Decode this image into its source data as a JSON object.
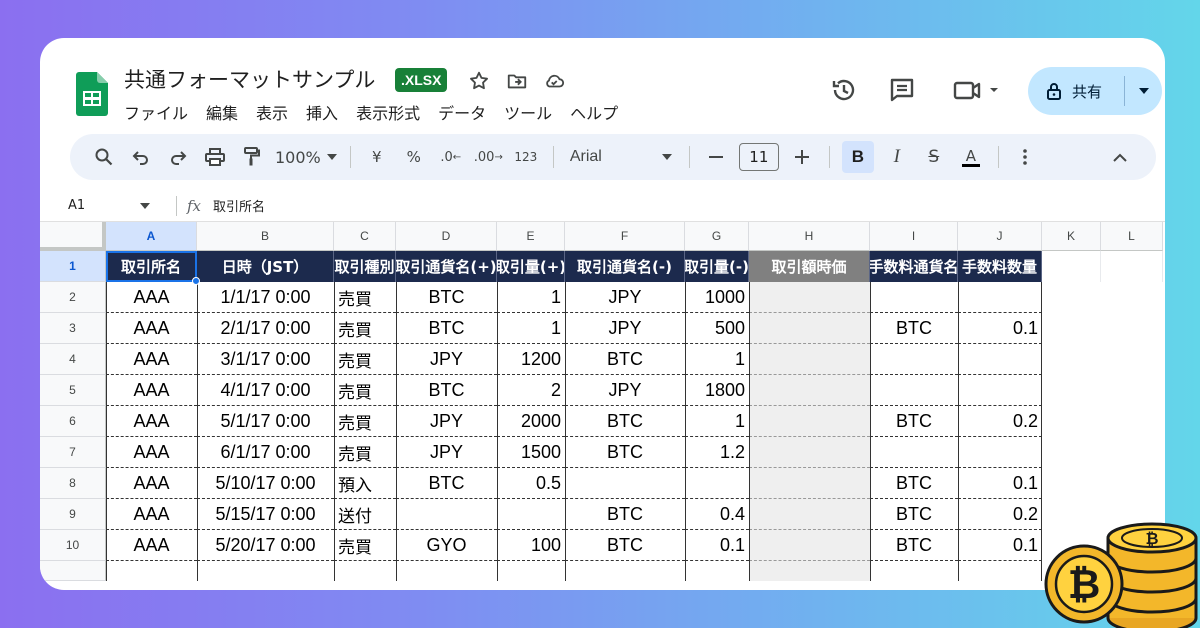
{
  "doc": {
    "title": "共通フォーマットサンプル",
    "badge": ".XLSX"
  },
  "menu": [
    "ファイル",
    "編集",
    "表示",
    "挿入",
    "表示形式",
    "データ",
    "ツール",
    "ヘルプ"
  ],
  "share": {
    "label": "共有"
  },
  "toolbar": {
    "zoom": "100%",
    "currency": "¥",
    "percent": "%",
    "dec_decrease": ".0",
    "dec_increase": ".00",
    "number_format": "123",
    "font": "Arial",
    "font_size": "11",
    "bold": "B",
    "italic": "I",
    "strike": "S",
    "text_color": "A"
  },
  "formula_bar": {
    "cell_ref": "A1",
    "fx": "fx",
    "content": "取引所名"
  },
  "columns": [
    "A",
    "B",
    "C",
    "D",
    "E",
    "F",
    "G",
    "H",
    "I",
    "J",
    "K",
    "L"
  ],
  "row_numbers": [
    "1",
    "2",
    "3",
    "4",
    "5",
    "6",
    "7",
    "8",
    "9",
    "10"
  ],
  "headers": [
    "取引所名",
    "日時（JST）",
    "取引種別",
    "取引通貨名(+)",
    "取引量(+)",
    "取引通貨名(-)",
    "取引量(-)",
    "取引額時価",
    "手数料通貨名",
    "手数料数量"
  ],
  "rows": [
    [
      "AAA",
      "1/1/17 0:00",
      "売買",
      "BTC",
      "1",
      "JPY",
      "1000",
      "",
      "",
      ""
    ],
    [
      "AAA",
      "2/1/17 0:00",
      "売買",
      "BTC",
      "1",
      "JPY",
      "500",
      "",
      "BTC",
      "0.1"
    ],
    [
      "AAA",
      "3/1/17 0:00",
      "売買",
      "JPY",
      "1200",
      "BTC",
      "1",
      "",
      "",
      ""
    ],
    [
      "AAA",
      "4/1/17 0:00",
      "売買",
      "BTC",
      "2",
      "JPY",
      "1800",
      "",
      "",
      ""
    ],
    [
      "AAA",
      "5/1/17 0:00",
      "売買",
      "JPY",
      "2000",
      "BTC",
      "1",
      "",
      "BTC",
      "0.2"
    ],
    [
      "AAA",
      "6/1/17 0:00",
      "売買",
      "JPY",
      "1500",
      "BTC",
      "1.2",
      "",
      "",
      ""
    ],
    [
      "AAA",
      "5/10/17 0:00",
      "預入",
      "BTC",
      "0.5",
      "",
      "",
      "",
      "BTC",
      "0.1"
    ],
    [
      "AAA",
      "5/15/17 0:00",
      "送付",
      "",
      "",
      "BTC",
      "0.4",
      "",
      "BTC",
      "0.2"
    ],
    [
      "AAA",
      "5/20/17 0:00",
      "売買",
      "GYO",
      "100",
      "BTC",
      "0.1",
      "",
      "BTC",
      "0.1"
    ]
  ],
  "colors": {
    "header_bg": "#1c2a4d",
    "header_gray": "#808080",
    "selection": "#1a73e8",
    "badge": "#188038",
    "share_bg": "#c2e7ff"
  }
}
